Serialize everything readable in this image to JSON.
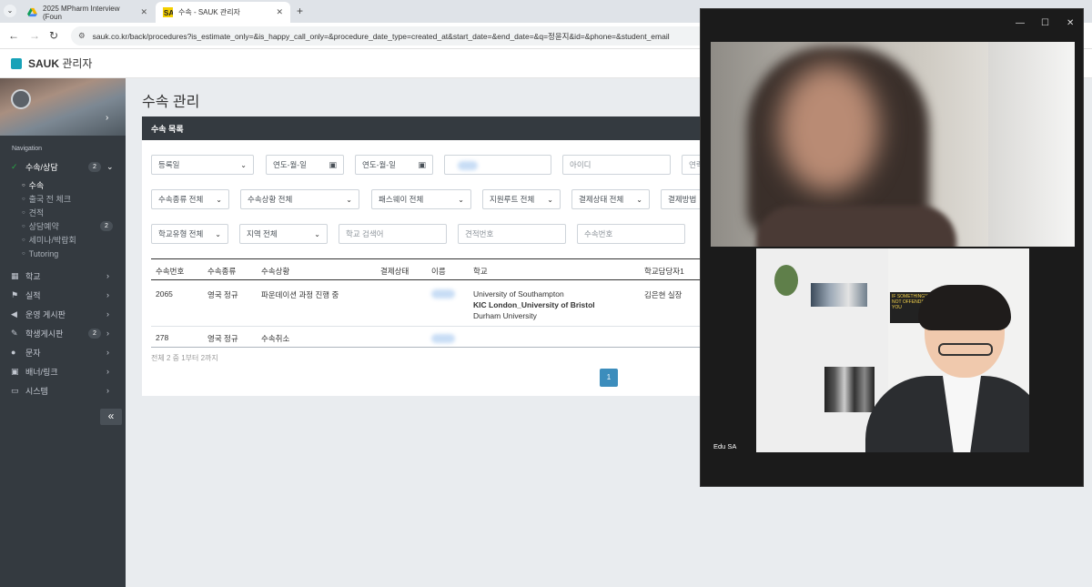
{
  "browser": {
    "tabs": [
      {
        "title": "2025 MPharm Interview (Foun"
      },
      {
        "title": "수속 - SAUK 관리자"
      }
    ],
    "url": "sauk.co.kr/back/procedures?is_estimate_only=&is_happy_call_only=&procedure_date_type=created_at&start_date=&end_date=&q=정윤지&id=&phone=&student_email",
    "new_tab": "+",
    "close": "✕"
  },
  "app": {
    "brand_bold": "SAUK",
    "brand_rest": " 관리자"
  },
  "sidebar": {
    "nav_heading": "Navigation",
    "active": {
      "label": "수속/상담",
      "badge": "2"
    },
    "subitems": [
      {
        "label": "수속"
      },
      {
        "label": "출국 전 체크"
      },
      {
        "label": "견적"
      },
      {
        "label": "상담예약",
        "badge": "2"
      },
      {
        "label": "세미나/박람회"
      },
      {
        "label": "Tutoring"
      }
    ],
    "items": [
      {
        "label": "학교"
      },
      {
        "label": "실적"
      },
      {
        "label": "운영 게시판"
      },
      {
        "label": "학생게시판",
        "badge": "2"
      },
      {
        "label": "문자"
      },
      {
        "label": "배너/링크"
      },
      {
        "label": "시스템"
      }
    ],
    "collapse": "«"
  },
  "page": {
    "title": "수속 관리",
    "card_title": "수속 목록"
  },
  "filters": {
    "date_type": "등록일",
    "start_date": "연도-월-일",
    "end_date": "연도-월-일",
    "id_placeholder": "아이디",
    "phone_placeholder": "연락",
    "procedure_type": "수속종류 전체",
    "procedure_status": "수속상황 전체",
    "pathway": "패스웨이 전체",
    "route": "지원루트 전체",
    "payment_status": "결제상태 전체",
    "payment_method": "결제방법",
    "school_type": "학교유형 전체",
    "region": "지역 전체",
    "school_search_placeholder": "학교 검색어",
    "estimate_no_placeholder": "견적번호",
    "procedure_no_placeholder": "수속번호"
  },
  "table": {
    "headers": [
      "수속번호",
      "수속종류",
      "수속상황",
      "결제상태",
      "이름",
      "학교",
      "학교담당자1"
    ],
    "rows": [
      {
        "no": "2065",
        "type": "영국 정규",
        "status": "파운데이션 과정 진행 중",
        "school_1": "University of Southampton",
        "school_2": "KIC London_University of Bristol",
        "school_3": "Durham University",
        "manager": "김은현 실장"
      },
      {
        "no": "278",
        "type": "영국 정규",
        "status": "수속취소"
      }
    ],
    "summary": "전체 2 중 1부터 2까지",
    "page": "1"
  },
  "video": {
    "participant_label": "Edu SA",
    "poster_text": "IF SOMETHING'S NOT OFFENDS YOU",
    "controls": {
      "minimize": "—",
      "maximize": "☐",
      "close": "✕"
    }
  }
}
